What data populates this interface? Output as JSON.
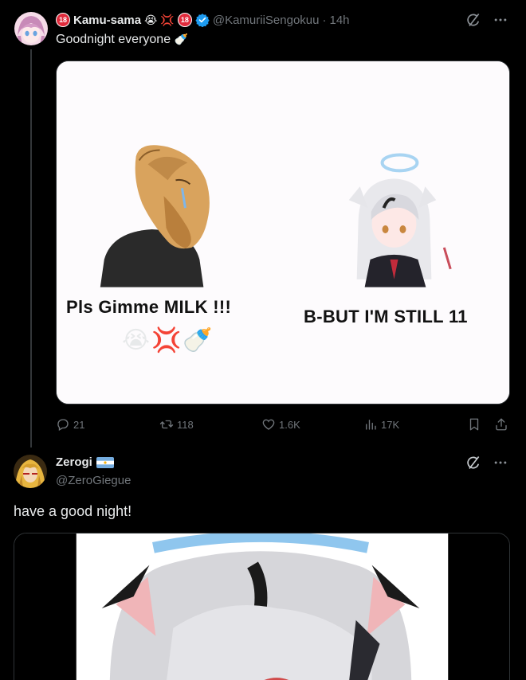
{
  "tweet1": {
    "display_name": "Kamu-sama",
    "name_prefix_badge": "18",
    "name_suffix_badge": "18",
    "name_emojis": [
      "😭",
      "💢"
    ],
    "handle": "@KamuriiSengokuu",
    "separator": "·",
    "time": "14h",
    "text": "Goodnight everyone",
    "text_emoji": "🍼",
    "meme": {
      "left_caption": "Pls Gimme MILK !!!",
      "right_caption": "B-BUT I'M STILL 11",
      "emojis": [
        "😭",
        "💢",
        "🍼"
      ]
    },
    "actions": {
      "replies": "21",
      "reposts": "118",
      "likes": "1.6K",
      "views": "17K"
    }
  },
  "tweet2": {
    "display_name": "Zerogi",
    "handle": "@ZeroGiegue",
    "text": "have a good night!"
  },
  "colors": {
    "background": "#000000",
    "text_primary": "#e7e9ea",
    "text_secondary": "#71767b",
    "verified": "#1d9bf0",
    "border": "#2f3336"
  },
  "icons": [
    "grok-icon",
    "more-icon",
    "reply-icon",
    "retweet-icon",
    "like-icon",
    "views-icon",
    "bookmark-icon",
    "share-icon",
    "verified-icon"
  ]
}
